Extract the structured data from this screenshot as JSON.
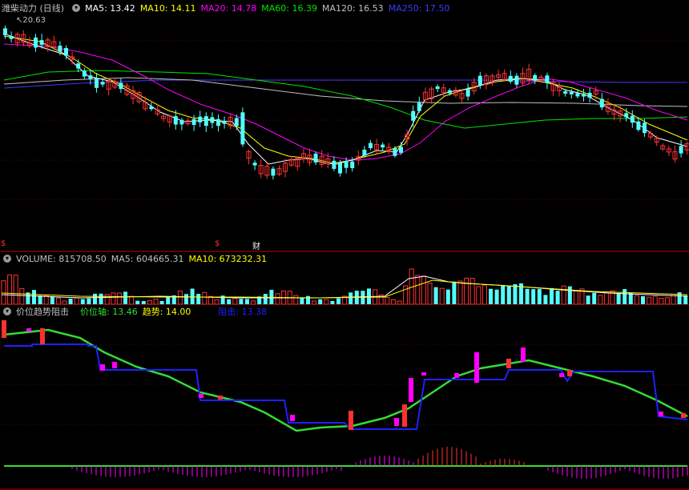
{
  "title": "潍柴动力 (日线)",
  "colors": {
    "up": "#ff3232",
    "down": "#54ffff",
    "ma5": "#ffffff",
    "ma10": "#ffff00",
    "ma20": "#ff00ff",
    "ma60": "#00e600",
    "ma120": "#c0c0c0",
    "ma250": "#3a3aff",
    "axis": "#c00000",
    "magenta": "#ff00ff",
    "green": "#33dd33",
    "blue": "#2020ff"
  },
  "main_indicator": {
    "items": [
      {
        "label": "MA5: 13.42",
        "color": "#ffffff"
      },
      {
        "label": "MA10: 14.11",
        "color": "#ffff00"
      },
      {
        "label": "MA20: 14.78",
        "color": "#ff00ff"
      },
      {
        "label": "MA60: 16.39",
        "color": "#00e600"
      },
      {
        "label": "MA120: 16.53",
        "color": "#c0c0c0"
      },
      {
        "label": "MA250: 17.50",
        "color": "#3a3aff"
      }
    ],
    "high_marker": "20.63"
  },
  "event_markers": {
    "m1": "$",
    "m2": "$",
    "m3": "财"
  },
  "volume_indicator": {
    "items": [
      {
        "label": "VOLUME: 815708.50",
        "color": "#c0c0c0"
      },
      {
        "label": "MA5: 604665.31",
        "color": "#c0c0c0"
      },
      {
        "label": "MA10: 673232.31",
        "color": "#ffff00"
      }
    ]
  },
  "trend_indicator": {
    "name": "价位趋势阻击",
    "items": [
      {
        "label": "价位轴: 13.46",
        "color": "#33dd33"
      },
      {
        "label": "趋势: 14.00",
        "color": "#ffff00"
      },
      {
        "label": "阻击: 13.38",
        "color": "#2020ff"
      }
    ]
  }
}
